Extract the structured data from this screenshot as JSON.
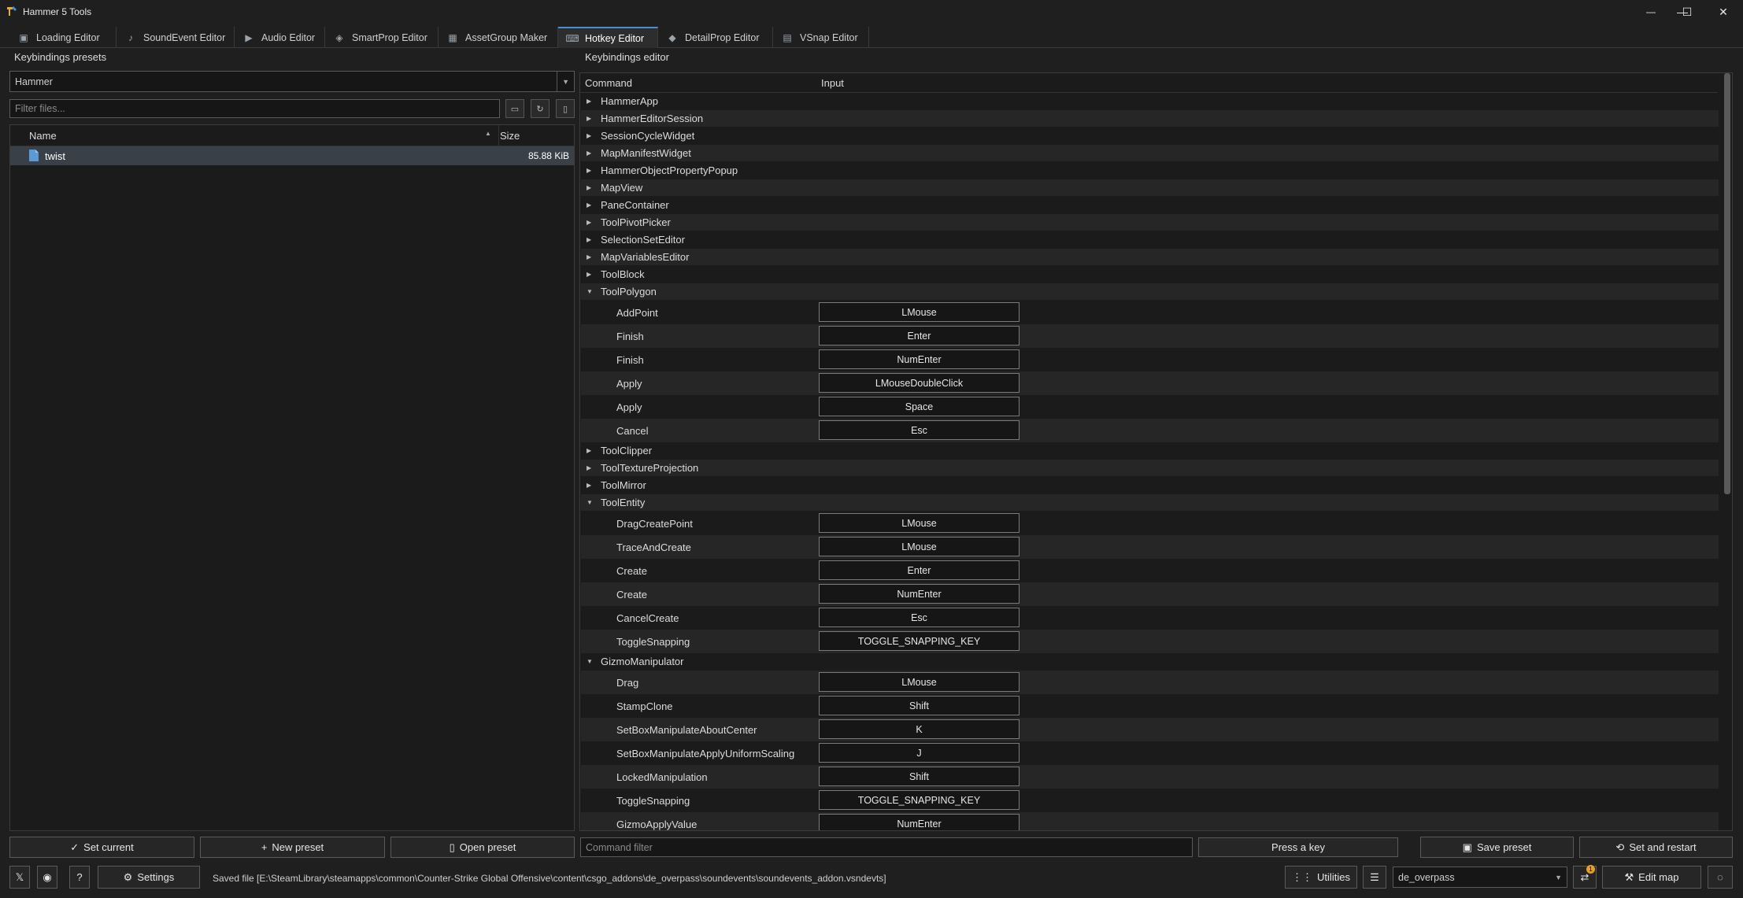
{
  "window": {
    "title": "Hammer 5 Tools",
    "minimize": "—",
    "maximize": "☐",
    "close": "✕"
  },
  "tabs": [
    {
      "label": "Loading Editor",
      "icon": "image-icon",
      "glyph": "▣"
    },
    {
      "label": "SoundEvent Editor",
      "icon": "sound-icon",
      "glyph": "♪"
    },
    {
      "label": "Audio Editor",
      "icon": "play-icon",
      "glyph": "▶"
    },
    {
      "label": "SmartProp Editor",
      "icon": "smartprop-icon",
      "glyph": "◈"
    },
    {
      "label": "AssetGroup Maker",
      "icon": "assetgroup-icon",
      "glyph": "▦"
    },
    {
      "label": "Hotkey Editor",
      "icon": "keyboard-icon",
      "glyph": "⌨"
    },
    {
      "label": "DetailProp Editor",
      "icon": "detailprop-icon",
      "glyph": "◆"
    },
    {
      "label": "VSnap Editor",
      "icon": "vsnap-icon",
      "glyph": "▤"
    }
  ],
  "presets": {
    "header": "Keybindings presets",
    "selected": "Hammer",
    "filter_placeholder": "Filter files...",
    "columns": {
      "name": "Name",
      "size": "Size"
    },
    "files": [
      {
        "name": "twist",
        "size": "85.88 KiB"
      }
    ]
  },
  "editor": {
    "header": "Keybindings editor",
    "columns": {
      "command": "Command",
      "input": "Input"
    },
    "groups": [
      {
        "name": "HammerApp",
        "expanded": false
      },
      {
        "name": "HammerEditorSession",
        "expanded": false
      },
      {
        "name": "SessionCycleWidget",
        "expanded": false
      },
      {
        "name": "MapManifestWidget",
        "expanded": false
      },
      {
        "name": "HammerObjectPropertyPopup",
        "expanded": false
      },
      {
        "name": "MapView",
        "expanded": false
      },
      {
        "name": "PaneContainer",
        "expanded": false
      },
      {
        "name": "ToolPivotPicker",
        "expanded": false
      },
      {
        "name": "SelectionSetEditor",
        "expanded": false
      },
      {
        "name": "MapVariablesEditor",
        "expanded": false
      },
      {
        "name": "ToolBlock",
        "expanded": false
      },
      {
        "name": "ToolPolygon",
        "expanded": true,
        "bindings": [
          {
            "command": "AddPoint",
            "input": "LMouse"
          },
          {
            "command": "Finish",
            "input": "Enter"
          },
          {
            "command": "Finish",
            "input": "NumEnter"
          },
          {
            "command": "Apply",
            "input": "LMouseDoubleClick"
          },
          {
            "command": "Apply",
            "input": "Space"
          },
          {
            "command": "Cancel",
            "input": "Esc"
          }
        ]
      },
      {
        "name": "ToolClipper",
        "expanded": false
      },
      {
        "name": "ToolTextureProjection",
        "expanded": false
      },
      {
        "name": "ToolMirror",
        "expanded": false
      },
      {
        "name": "ToolEntity",
        "expanded": true,
        "bindings": [
          {
            "command": "DragCreatePoint",
            "input": "LMouse"
          },
          {
            "command": "TraceAndCreate",
            "input": "LMouse"
          },
          {
            "command": "Create",
            "input": "Enter"
          },
          {
            "command": "Create",
            "input": "NumEnter"
          },
          {
            "command": "CancelCreate",
            "input": "Esc"
          },
          {
            "command": "ToggleSnapping",
            "input": "TOGGLE_SNAPPING_KEY"
          }
        ]
      },
      {
        "name": "GizmoManipulator",
        "expanded": true,
        "bindings": [
          {
            "command": "Drag",
            "input": "LMouse"
          },
          {
            "command": "StampClone",
            "input": "Shift"
          },
          {
            "command": "SetBoxManipulateAboutCenter",
            "input": "K"
          },
          {
            "command": "SetBoxManipulateApplyUniformScaling",
            "input": "J"
          },
          {
            "command": "LockedManipulation",
            "input": "Shift"
          },
          {
            "command": "ToggleSnapping",
            "input": "TOGGLE_SNAPPING_KEY"
          },
          {
            "command": "GizmoApplyValue",
            "input": "NumEnter"
          }
        ]
      }
    ],
    "command_filter_placeholder": "Command filter",
    "press_key_label": "Press a key",
    "save_preset_label": "Save preset",
    "set_restart_label": "Set and restart"
  },
  "preset_buttons": {
    "set_current": "Set current",
    "new_preset": "New preset",
    "open_preset": "Open preset"
  },
  "status": {
    "settings_label": "Settings",
    "message": "Saved file [E:\\SteamLibrary\\steamapps\\common\\Counter-Strike Global Offensive\\content\\csgo_addons\\de_overpass\\soundevents\\soundevents_addon.vsndevts]",
    "utilities_label": "Utilities",
    "addon": "de_overpass",
    "sync_badge": "1",
    "edit_map_label": "Edit map"
  },
  "colors": {
    "accent": "#4a8fd6",
    "background": "#1f1f1f",
    "badge": "#e8a01c"
  }
}
